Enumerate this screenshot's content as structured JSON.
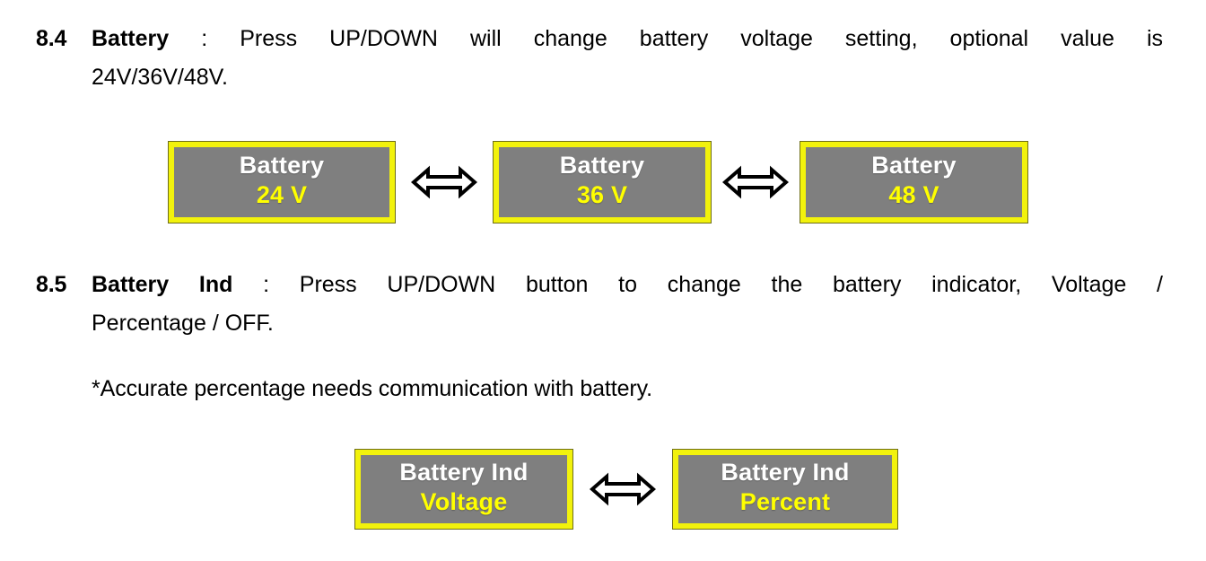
{
  "sections": [
    {
      "number": "8.4",
      "term": "Battery",
      "separator": ":",
      "line1_rest": "Press UP/DOWN will change battery voltage setting, optional value is",
      "line2": "24V/36V/48V."
    },
    {
      "number": "8.5",
      "term": "Battery Ind",
      "separator": ":",
      "line1_rest": "Press UP/DOWN button to change the battery indicator, Voltage /",
      "line2": "Percentage / OFF."
    }
  ],
  "note": "*Accurate percentage needs communication with battery.",
  "diagrams": [
    {
      "id": "battery-voltage-states",
      "boxes": [
        {
          "title": "Battery",
          "value": "24 V"
        },
        {
          "title": "Battery",
          "value": "36 V"
        },
        {
          "title": "Battery",
          "value": "48 V"
        }
      ],
      "arrow_count": 2
    },
    {
      "id": "battery-indicator-states",
      "boxes": [
        {
          "title": "Battery Ind",
          "value": "Voltage"
        },
        {
          "title": "Battery Ind",
          "value": "Percent"
        }
      ],
      "arrow_count": 1
    }
  ],
  "colors": {
    "lcd_bezel": "#F2F20C",
    "lcd_screen": "#7F7F7F",
    "lcd_title_text": "#FFFFFF",
    "lcd_value_text": "#FFFF00",
    "body_text": "#000000",
    "page_background": "#FFFFFF"
  },
  "icons": {
    "arrow": "double-headed-arrow-icon"
  }
}
